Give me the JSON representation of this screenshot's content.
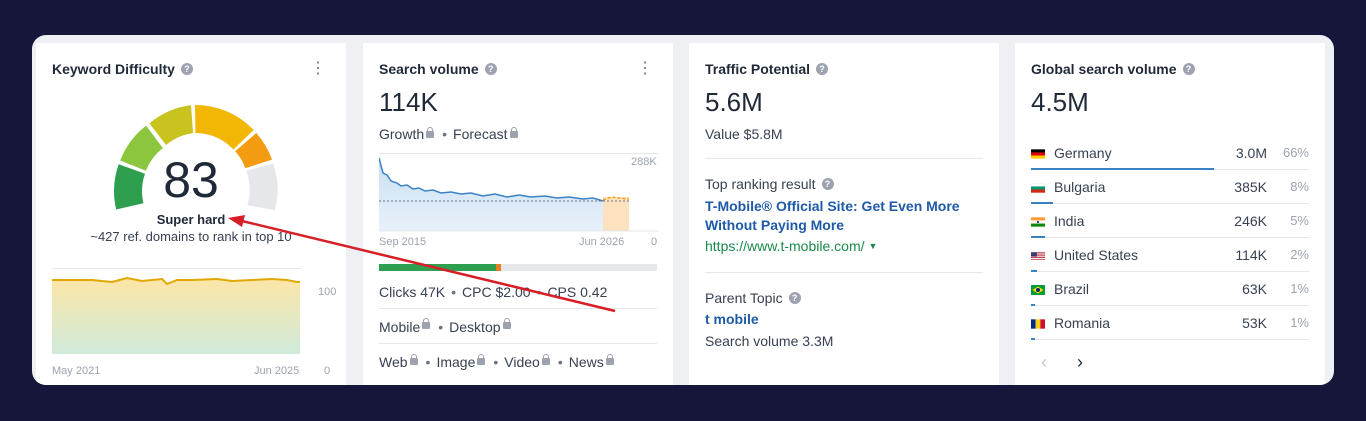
{
  "kd": {
    "title": "Keyword Difficulty",
    "score": "83",
    "label": "Super hard",
    "note": "~427 ref. domains to rank in top 10",
    "chart_max": "100",
    "chart_min": "0",
    "chart_start": "May 2021",
    "chart_end": "Jun 2025"
  },
  "sv": {
    "title": "Search volume",
    "value": "114K",
    "growth": "Growth",
    "forecast": "Forecast",
    "chart_max": "288K",
    "chart_min": "0",
    "chart_start": "Sep 2015",
    "chart_end": "Jun 2026",
    "clicks": "Clicks 47K",
    "cpc": "CPC $2.00",
    "cps": "CPS 0.42",
    "mobile": "Mobile",
    "desktop": "Desktop",
    "web": "Web",
    "image": "Image",
    "video": "Video",
    "news": "News"
  },
  "tp": {
    "title": "Traffic Potential",
    "value": "5.6M",
    "value_usd": "Value $5.8M",
    "top_label": "Top ranking result",
    "top_link": "T-Mobile® Official Site: Get Even More Without Paying More",
    "top_url": "https://www.t-mobile.com/",
    "parent_label": "Parent Topic",
    "parent_link": "t mobile",
    "parent_volume": "Search volume 3.3M"
  },
  "gsv": {
    "title": "Global search volume",
    "value": "4.5M",
    "countries": [
      {
        "name": "Germany",
        "value": "3.0M",
        "pct": "66%",
        "share": 0.66
      },
      {
        "name": "Bulgaria",
        "value": "385K",
        "pct": "8%",
        "share": 0.08
      },
      {
        "name": "India",
        "value": "246K",
        "pct": "5%",
        "share": 0.05
      },
      {
        "name": "United States",
        "value": "114K",
        "pct": "2%",
        "share": 0.02
      },
      {
        "name": "Brazil",
        "value": "63K",
        "pct": "1%",
        "share": 0.01
      },
      {
        "name": "Romania",
        "value": "53K",
        "pct": "1%",
        "share": 0.01
      }
    ]
  },
  "colors": {
    "background": "#15163a",
    "accent_link": "#1e5aa8",
    "url_green": "#1a8a4a",
    "arrow_red": "#d61f26",
    "gauge_fill": [
      "#2e9e4f",
      "#8cc63f",
      "#d8c21c",
      "#f2b705",
      "#f39c12"
    ]
  }
}
